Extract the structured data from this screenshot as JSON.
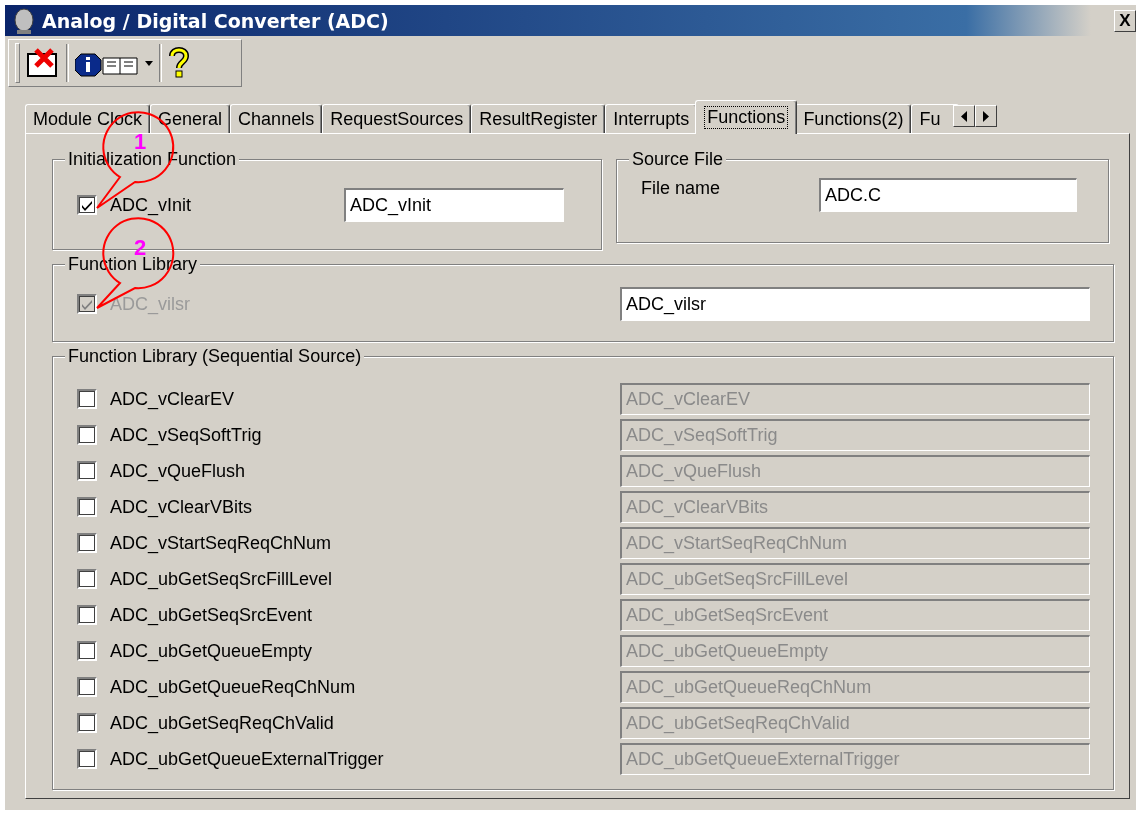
{
  "window": {
    "title": "Analog / Digital Converter (ADC)",
    "close": "X"
  },
  "tabs": [
    {
      "label": "Module Clock",
      "selected": false
    },
    {
      "label": "General",
      "selected": false
    },
    {
      "label": "Channels",
      "selected": false
    },
    {
      "label": "RequestSources",
      "selected": false
    },
    {
      "label": "ResultRegister",
      "selected": false
    },
    {
      "label": "Interrupts",
      "selected": false
    },
    {
      "label": "Functions",
      "selected": true
    },
    {
      "label": "Functions(2)",
      "selected": false
    },
    {
      "label": "Fu",
      "selected": false
    }
  ],
  "initialization_function": {
    "title": "Initialization Function",
    "items": [
      {
        "label": "ADC_vInit",
        "checked": true,
        "disabled": false,
        "value": "ADC_vInit",
        "field_disabled": false
      }
    ]
  },
  "source_file": {
    "title": "Source File",
    "label": "File name",
    "value": "ADC.C"
  },
  "function_library": {
    "title": "Function Library",
    "items": [
      {
        "label": "ADC_vilsr",
        "checked": true,
        "disabled": true,
        "value": "ADC_vilsr",
        "field_disabled": false
      }
    ]
  },
  "function_library_sequential": {
    "title": "Function Library (Sequential Source)",
    "items": [
      {
        "label": "ADC_vClearEV",
        "checked": false,
        "disabled": false,
        "value": "ADC_vClearEV",
        "field_disabled": true
      },
      {
        "label": "ADC_vSeqSoftTrig",
        "checked": false,
        "disabled": false,
        "value": "ADC_vSeqSoftTrig",
        "field_disabled": true
      },
      {
        "label": "ADC_vQueFlush",
        "checked": false,
        "disabled": false,
        "value": "ADC_vQueFlush",
        "field_disabled": true
      },
      {
        "label": "ADC_vClearVBits",
        "checked": false,
        "disabled": false,
        "value": "ADC_vClearVBits",
        "field_disabled": true
      },
      {
        "label": "ADC_vStartSeqReqChNum",
        "checked": false,
        "disabled": false,
        "value": "ADC_vStartSeqReqChNum",
        "field_disabled": true
      },
      {
        "label": "ADC_ubGetSeqSrcFillLevel",
        "checked": false,
        "disabled": false,
        "value": "ADC_ubGetSeqSrcFillLevel",
        "field_disabled": true
      },
      {
        "label": "ADC_ubGetSeqSrcEvent",
        "checked": false,
        "disabled": false,
        "value": "ADC_ubGetSeqSrcEvent",
        "field_disabled": true
      },
      {
        "label": "ADC_ubGetQueueEmpty",
        "checked": false,
        "disabled": false,
        "value": "ADC_ubGetQueueEmpty",
        "field_disabled": true
      },
      {
        "label": "ADC_ubGetQueueReqChNum",
        "checked": false,
        "disabled": false,
        "value": "ADC_ubGetQueueReqChNum",
        "field_disabled": true
      },
      {
        "label": "ADC_ubGetSeqReqChValid",
        "checked": false,
        "disabled": false,
        "value": "ADC_ubGetSeqReqChValid",
        "field_disabled": true
      },
      {
        "label": "ADC_ubGetQueueExternalTrigger",
        "checked": false,
        "disabled": false,
        "value": "ADC_ubGetQueueExternalTrigger",
        "field_disabled": true
      }
    ]
  },
  "callouts": [
    {
      "label": "1"
    },
    {
      "label": "2"
    }
  ]
}
